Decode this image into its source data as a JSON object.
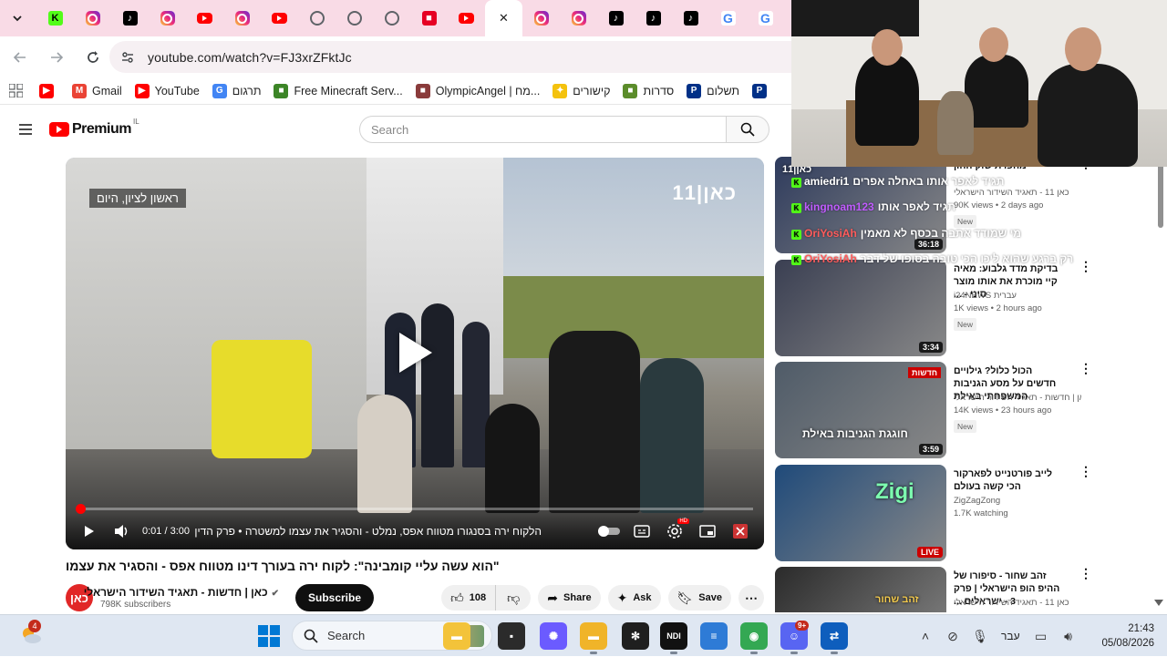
{
  "browser": {
    "tabs": [
      {
        "icon": "kick-icon",
        "kind": "k",
        "glyph": "K"
      },
      {
        "icon": "instagram-icon",
        "kind": "ig",
        "glyph": ""
      },
      {
        "icon": "tiktok-icon",
        "kind": "tt",
        "glyph": "♪"
      },
      {
        "icon": "instagram-icon",
        "kind": "ig",
        "glyph": ""
      },
      {
        "icon": "youtube-icon",
        "kind": "yt",
        "glyph": ""
      },
      {
        "icon": "instagram-icon",
        "kind": "ig",
        "glyph": ""
      },
      {
        "icon": "youtube-icon",
        "kind": "yt",
        "glyph": ""
      },
      {
        "icon": "github-icon",
        "kind": "gh",
        "glyph": ""
      },
      {
        "icon": "github-icon",
        "kind": "gh",
        "glyph": ""
      },
      {
        "icon": "github-icon",
        "kind": "gh",
        "glyph": ""
      },
      {
        "icon": "pinterest-icon",
        "kind": "pin",
        "glyph": "■"
      },
      {
        "icon": "youtube-icon",
        "kind": "yt",
        "glyph": ""
      },
      {
        "icon": "close-icon",
        "kind": "active",
        "glyph": "✕"
      },
      {
        "icon": "instagram-icon",
        "kind": "ig",
        "glyph": ""
      },
      {
        "icon": "instagram-icon",
        "kind": "ig",
        "glyph": ""
      },
      {
        "icon": "tiktok-icon",
        "kind": "tt",
        "glyph": "♪"
      },
      {
        "icon": "tiktok-icon",
        "kind": "tt",
        "glyph": "♪"
      },
      {
        "icon": "tiktok-icon",
        "kind": "tt",
        "glyph": "♪"
      },
      {
        "icon": "google-icon",
        "kind": "g",
        "glyph": "G"
      },
      {
        "icon": "google-icon",
        "kind": "g",
        "glyph": "G"
      },
      {
        "icon": "google-icon",
        "kind": "g",
        "glyph": "G"
      }
    ],
    "url": "youtube.com/watch?v=FJ3xrZFktJc",
    "bookmarks": [
      {
        "label": "",
        "icon": "youtube-icon",
        "color": "#ff0000",
        "glyph": "▶"
      },
      {
        "label": "Gmail",
        "icon": "gmail-icon",
        "color": "#ea4335",
        "glyph": "M"
      },
      {
        "label": "YouTube",
        "icon": "youtube-icon",
        "color": "#ff0000",
        "glyph": "▶"
      },
      {
        "label": "תרגום",
        "icon": "translate-icon",
        "color": "#4285f4",
        "glyph": "G"
      },
      {
        "label": "Free Minecraft Serv...",
        "icon": "minecraft-icon",
        "color": "#3c8527",
        "glyph": "■"
      },
      {
        "label": "OlympicAngel | מח...",
        "icon": "avatar-icon",
        "color": "#8a3b3b",
        "glyph": "■"
      },
      {
        "label": "קישורים",
        "icon": "star-icon",
        "color": "#f4c20d",
        "glyph": "✦"
      },
      {
        "label": "סדרות",
        "icon": "tv-icon",
        "color": "#5b8c2a",
        "glyph": "■"
      },
      {
        "label": "תשלום",
        "icon": "paypal-icon",
        "color": "#003087",
        "glyph": "P"
      },
      {
        "label": "",
        "icon": "paypal-icon",
        "color": "#003087",
        "glyph": "P"
      }
    ]
  },
  "youtube": {
    "logo_text": "Premium",
    "logo_region": "IL",
    "search_placeholder": "Search"
  },
  "player": {
    "channel_logo": "כאן|11",
    "location_tag": "ראשון לציון, היום",
    "time_current": "0:01",
    "time_total": "3:00",
    "time_display": "0:01 / 3:00",
    "chapter": "הלקוח ירה בסנגורו מטווח אפס, נמלט - והסגיר את עצמו למשטרה • פרק הדין",
    "progress": 0.0056
  },
  "video": {
    "title": "\"הוא עשה עליי קומבינה\": לקוח ירה בעורך דינו מטווח אפס - והסגיר את עצמו",
    "channel_name": "כאן | חדשות - תאגיד השידור הישראלי",
    "channel_avatar": "כאן",
    "subscribers": "798K subscribers",
    "subscribe_label": "Subscribe",
    "likes": "108",
    "share_label": "Share",
    "ask_label": "Ask",
    "save_label": "Save"
  },
  "recommendations": [
    {
      "title": "מהפרת שוק ההון",
      "channel": "כאן 11 - תאגיד השידור הישראלי",
      "views": "90K views • 2 days ago",
      "badge": "New",
      "duration": "36:18",
      "live": false,
      "thumb_color": "#2d3a5c"
    },
    {
      "title": "בדיקת מדד גלבוע: מאיה קיי מוכרת את אותו מוצר סיני - ...",
      "channel": "i24NEWS עברית",
      "views": "1K views • 2 hours ago",
      "badge": "New",
      "duration": "3:34",
      "live": false,
      "thumb_color": "#3a3f52"
    },
    {
      "title": "הכול כלול? גילויים חדשים על מסע הגניבות המשפחתי באילת",
      "channel": "כאן | חדשות - תאגיד השידור הישראלי",
      "views": "14K views • 23 hours ago",
      "badge": "New",
      "duration": "3:59",
      "live": false,
      "thumb_color": "#4f5b68"
    },
    {
      "title": "לייב פורטנייט לפארקור הכי קשה בעולם",
      "channel": "ZigZagZong",
      "views": "1.7K watching",
      "badge": "",
      "duration": "LIVE",
      "live": true,
      "thumb_color": "#1f4a7a"
    },
    {
      "title": "זהב שחור - סיפורו של ההיפ הופ הישראלי | פרק 3 - ישראלים ...",
      "channel": "כאן 11 - תאגיד השידור הישראלי",
      "views": "",
      "badge": "",
      "duration": "",
      "live": false,
      "thumb_color": "#2a2a2a"
    }
  ],
  "thumb_overlays": {
    "rec1_logo": "כאן|11",
    "rec3_tag": "חדשות",
    "rec3_caption": "חוגגת הגניבות באילת",
    "rec4_caption": "Zigi",
    "rec5_caption": "זהב שחור"
  },
  "chat": [
    {
      "nick": "amiedri1",
      "nick_color": "#ffffff",
      "msg": "תגיד לאפר אותו באחלה אפרים",
      "badge": "K"
    },
    {
      "nick": "kingnoam123",
      "nick_color": "#c15cff",
      "msg": "תגיד לאפר אותו",
      "badge": "K"
    },
    {
      "nick": "OriYosiAh",
      "nick_color": "#ff5c5c",
      "msg": "מי שמודד אתבה בכסף לא מאמין",
      "badge": "K"
    },
    {
      "nick": "OriYosiAh",
      "nick_color": "#ff5c5c",
      "msg": "רק ברגע שהוא ליכו הכי טובה בסופו של דבר",
      "badge": "K"
    }
  ],
  "taskbar": {
    "weather_badge": "4",
    "search_label": "Search",
    "apps": [
      {
        "icon": "file-explorer-icon",
        "color": "#f3c33a",
        "glyph": "▬"
      },
      {
        "icon": "terminal-icon",
        "color": "#2b2b2b",
        "glyph": "▪"
      },
      {
        "icon": "copilot-icon",
        "color": "#6b5bff",
        "glyph": "✺"
      },
      {
        "icon": "folder-icon",
        "color": "#f0b429",
        "glyph": "▬"
      },
      {
        "icon": "chatgpt-icon",
        "color": "#1f1f1f",
        "glyph": "✻"
      },
      {
        "icon": "ndi-icon",
        "color": "#111111",
        "glyph": "NDI"
      },
      {
        "icon": "notepad-icon",
        "color": "#2e7bd6",
        "glyph": "≡"
      },
      {
        "icon": "chrome-icon",
        "color": "#34a853",
        "glyph": "◉"
      },
      {
        "icon": "discord-icon",
        "color": "#5865f2",
        "glyph": "☺"
      },
      {
        "icon": "teamviewer-icon",
        "color": "#0e5ebd",
        "glyph": "⇄"
      }
    ],
    "discord_badge": "9+",
    "language": "עבר",
    "time": "21:43",
    "date": "05/08/2026"
  }
}
